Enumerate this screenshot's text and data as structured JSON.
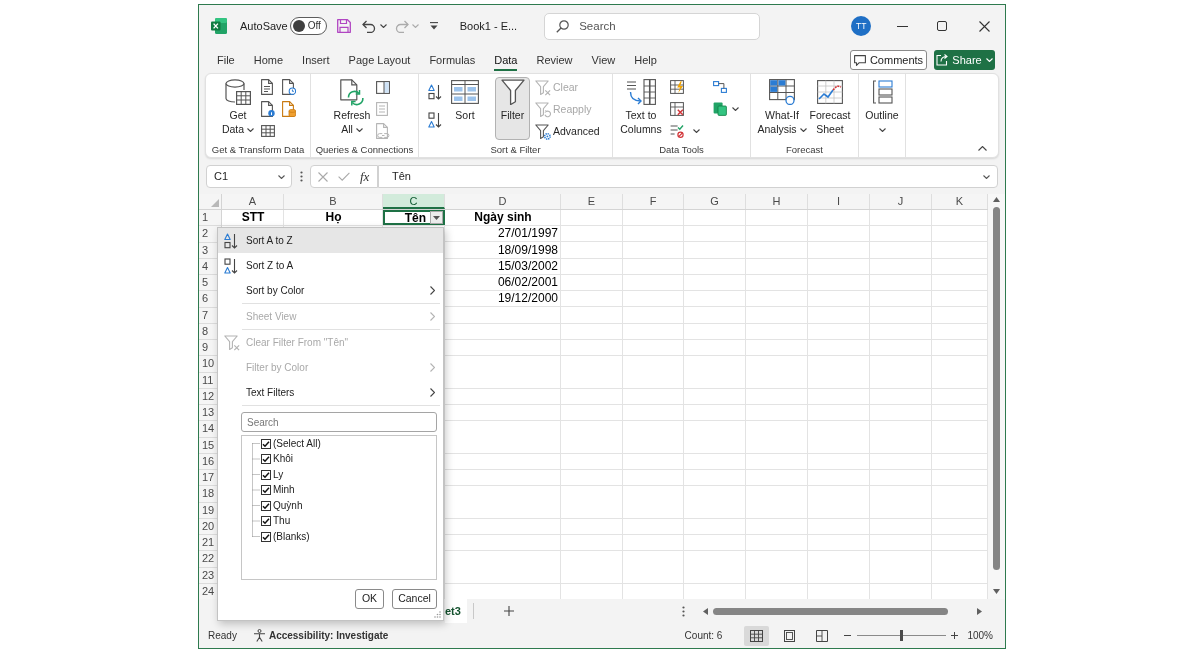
{
  "title_bar": {
    "autosave": {
      "label": "AutoSave",
      "on": false,
      "state_label": "Off"
    },
    "document_title": "Book1 - E...",
    "search": {
      "placeholder": "Search"
    },
    "user_initials": "TT"
  },
  "ribbon_tabs": [
    {
      "label": "File",
      "selected": false
    },
    {
      "label": "Home",
      "selected": false
    },
    {
      "label": "Insert",
      "selected": false
    },
    {
      "label": "Page Layout",
      "selected": false
    },
    {
      "label": "Formulas",
      "selected": false
    },
    {
      "label": "Data",
      "selected": true
    },
    {
      "label": "Review",
      "selected": false
    },
    {
      "label": "View",
      "selected": false
    },
    {
      "label": "Help",
      "selected": false
    }
  ],
  "comments_button": {
    "label": "Comments"
  },
  "share_button": {
    "label": "Share"
  },
  "ribbon_groups": [
    {
      "label": "Get & Transform Data",
      "buttons": [
        {
          "label": "Get Data",
          "dropdown": true,
          "pressed": false
        }
      ]
    },
    {
      "label": "Queries & Connections",
      "buttons": [
        {
          "label": "Refresh All",
          "dropdown": true,
          "pressed": false
        }
      ],
      "small_buttons": [
        {
          "disabled": false
        },
        {
          "disabled": true
        },
        {
          "disabled": true
        }
      ]
    },
    {
      "label": "Sort & Filter",
      "buttons": [
        {
          "label": "Sort",
          "dropdown": false,
          "pressed": false
        },
        {
          "label": "Filter",
          "dropdown": false,
          "pressed": true
        }
      ],
      "commands": [
        {
          "label": "Clear",
          "disabled": true
        },
        {
          "label": "Reapply",
          "disabled": true
        },
        {
          "label": "Advanced",
          "disabled": false
        }
      ]
    },
    {
      "label": "Data Tools",
      "buttons": [
        {
          "label": "Text to Columns",
          "dropdown": false,
          "pressed": false
        }
      ]
    },
    {
      "label": "Forecast",
      "buttons": [
        {
          "label": "What-If Analysis",
          "dropdown": true,
          "pressed": false
        },
        {
          "label": "Forecast Sheet",
          "dropdown": false,
          "pressed": false
        }
      ]
    },
    {
      "buttons": [
        {
          "label": "Outline",
          "dropdown": true,
          "pressed": false
        }
      ]
    }
  ],
  "formula_bar": {
    "name_box": "C1",
    "insert_function": "fx",
    "formula": "Tên"
  },
  "sheet": {
    "columns": [
      {
        "label": "A",
        "selected": false
      },
      {
        "label": "B",
        "selected": false
      },
      {
        "label": "C",
        "selected": true
      },
      {
        "label": "D",
        "selected": false
      },
      {
        "label": "E",
        "selected": false
      },
      {
        "label": "F",
        "selected": false
      },
      {
        "label": "G",
        "selected": false
      },
      {
        "label": "H",
        "selected": false
      },
      {
        "label": "I",
        "selected": false
      },
      {
        "label": "J",
        "selected": false
      },
      {
        "label": "K",
        "selected": false
      }
    ],
    "rows": [
      {
        "number": "1",
        "cells": [
          {
            "text": "STT",
            "selected": false,
            "filter_button": false
          },
          {
            "text": "Họ",
            "selected": false,
            "filter_button": false
          },
          {
            "text": "Tên",
            "selected": true,
            "filter_button": true
          },
          {
            "text": "Ngày sinh",
            "selected": false,
            "filter_button": false
          }
        ]
      },
      {
        "number": "2",
        "cells": [
          null,
          null,
          null,
          {
            "text": "27/01/1997",
            "selected": false
          }
        ]
      },
      {
        "number": "3",
        "cells": [
          null,
          null,
          null,
          {
            "text": "18/09/1998",
            "selected": false
          }
        ]
      },
      {
        "number": "4",
        "cells": [
          null,
          null,
          null,
          {
            "text": "15/03/2002",
            "selected": false
          }
        ]
      },
      {
        "number": "5",
        "cells": [
          null,
          null,
          null,
          {
            "text": "06/02/2001",
            "selected": false
          }
        ]
      },
      {
        "number": "6",
        "cells": [
          null,
          null,
          null,
          {
            "text": "19/12/2000",
            "selected": false
          }
        ]
      },
      {
        "number": "7"
      },
      {
        "number": "8"
      },
      {
        "number": "9"
      },
      {
        "number": "10"
      },
      {
        "number": "11"
      },
      {
        "number": "12"
      },
      {
        "number": "13"
      },
      {
        "number": "14"
      },
      {
        "number": "15"
      },
      {
        "number": "16"
      },
      {
        "number": "17"
      },
      {
        "number": "18"
      },
      {
        "number": "19"
      },
      {
        "number": "20"
      },
      {
        "number": "21"
      },
      {
        "number": "22"
      },
      {
        "number": "23"
      },
      {
        "number": "24"
      }
    ]
  },
  "filter_menu": {
    "items": [
      {
        "kind": "command",
        "label": "Sort A to Z",
        "highlighted": true,
        "disabled": false
      },
      {
        "kind": "command",
        "label": "Sort Z to A",
        "highlighted": false,
        "disabled": false
      },
      {
        "kind": "submenu",
        "label": "Sort by Color",
        "highlighted": false,
        "disabled": false
      },
      {
        "kind": "separator"
      },
      {
        "kind": "submenu",
        "label": "Sheet View",
        "highlighted": false,
        "disabled": true
      },
      {
        "kind": "separator"
      },
      {
        "kind": "command",
        "label": "Clear Filter From \"Tên\"",
        "highlighted": false,
        "disabled": true
      },
      {
        "kind": "submenu",
        "label": "Filter by Color",
        "highlighted": false,
        "disabled": true
      },
      {
        "kind": "submenu",
        "label": "Text Filters",
        "highlighted": false,
        "disabled": false
      },
      {
        "kind": "separator"
      }
    ],
    "search": {
      "placeholder": "Search"
    },
    "values": [
      {
        "label": "(Select All)",
        "checked": true
      },
      {
        "label": "Khôi",
        "checked": true
      },
      {
        "label": "Ly",
        "checked": true
      },
      {
        "label": "Minh",
        "checked": true
      },
      {
        "label": "Quỳnh",
        "checked": true
      },
      {
        "label": "Thu",
        "checked": true
      },
      {
        "label": "(Blanks)",
        "checked": true
      }
    ],
    "buttons": [
      {
        "label": "OK"
      },
      {
        "label": "Cancel"
      }
    ]
  },
  "sheet_tabs": [
    {
      "label": "et3",
      "selected": true
    }
  ],
  "status_bar": {
    "status": "Ready",
    "accessibility": "Accessibility: Investigate",
    "count": "Count: 6",
    "views": [
      {
        "selected": true
      },
      {
        "selected": false
      },
      {
        "selected": false
      }
    ],
    "zoom": {
      "level": 0.5,
      "reading": "100%"
    }
  }
}
